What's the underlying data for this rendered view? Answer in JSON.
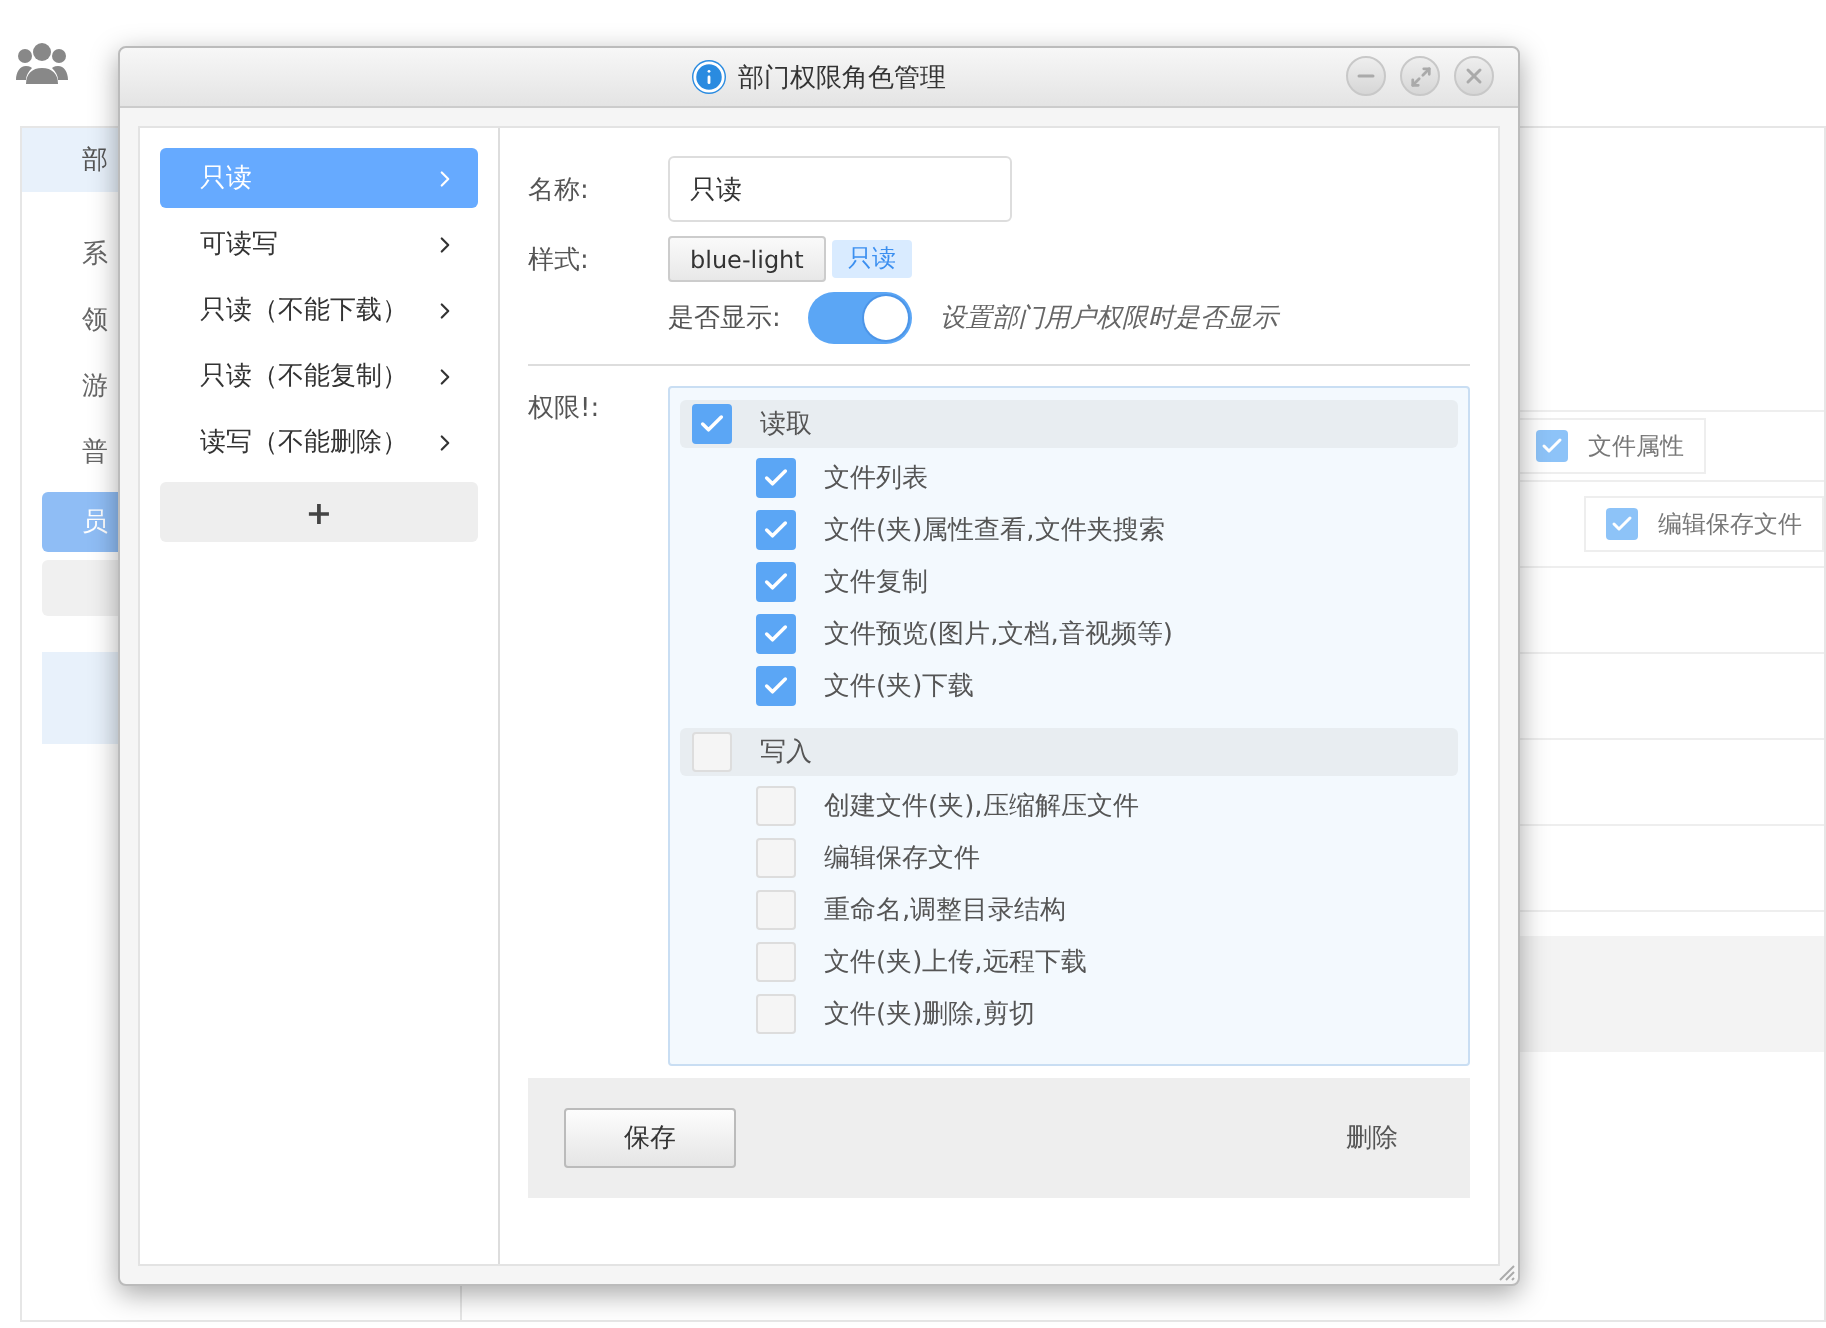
{
  "background": {
    "sidebar_tab": "部",
    "sidebar_items": [
      {
        "label": "系",
        "selected": false
      },
      {
        "label": "领",
        "selected": false
      },
      {
        "label": "游",
        "selected": false
      },
      {
        "label": "普",
        "selected": false
      },
      {
        "label": "员",
        "selected": true
      }
    ],
    "chips": [
      {
        "label": "文件属性",
        "checked": true
      },
      {
        "label": "编辑保存文件",
        "checked": true
      }
    ]
  },
  "dialog": {
    "title": "部门权限角色管理",
    "roles": [
      {
        "label": "只读",
        "selected": true
      },
      {
        "label": "可读写",
        "selected": false
      },
      {
        "label": "只读（不能下载）",
        "selected": false
      },
      {
        "label": "只读（不能复制）",
        "selected": false
      },
      {
        "label": "读写（不能删除）",
        "selected": false
      }
    ],
    "add_button": "+",
    "form": {
      "name_label": "名称:",
      "name_value": "只读",
      "style_label": "样式:",
      "style_button": "blue-light",
      "style_tag": "只读",
      "display_label": "是否显示:",
      "display_on": true,
      "display_hint": "设置部门用户权限时是否显示",
      "permissions_label": "权限!:",
      "groups": [
        {
          "label": "读取",
          "checked": true,
          "items": [
            {
              "label": "文件列表",
              "checked": true
            },
            {
              "label": "文件(夹)属性查看,文件夹搜索",
              "checked": true
            },
            {
              "label": "文件复制",
              "checked": true
            },
            {
              "label": "文件预览(图片,文档,音视频等)",
              "checked": true
            },
            {
              "label": "文件(夹)下载",
              "checked": true
            }
          ]
        },
        {
          "label": "写入",
          "checked": false,
          "items": [
            {
              "label": "创建文件(夹),压缩解压文件",
              "checked": false
            },
            {
              "label": "编辑保存文件",
              "checked": false
            },
            {
              "label": "重命名,调整目录结构",
              "checked": false
            },
            {
              "label": "文件(夹)上传,远程下载",
              "checked": false
            },
            {
              "label": "文件(夹)删除,剪切",
              "checked": false
            }
          ]
        }
      ]
    },
    "save_button": "保存",
    "delete_button": "删除"
  }
}
